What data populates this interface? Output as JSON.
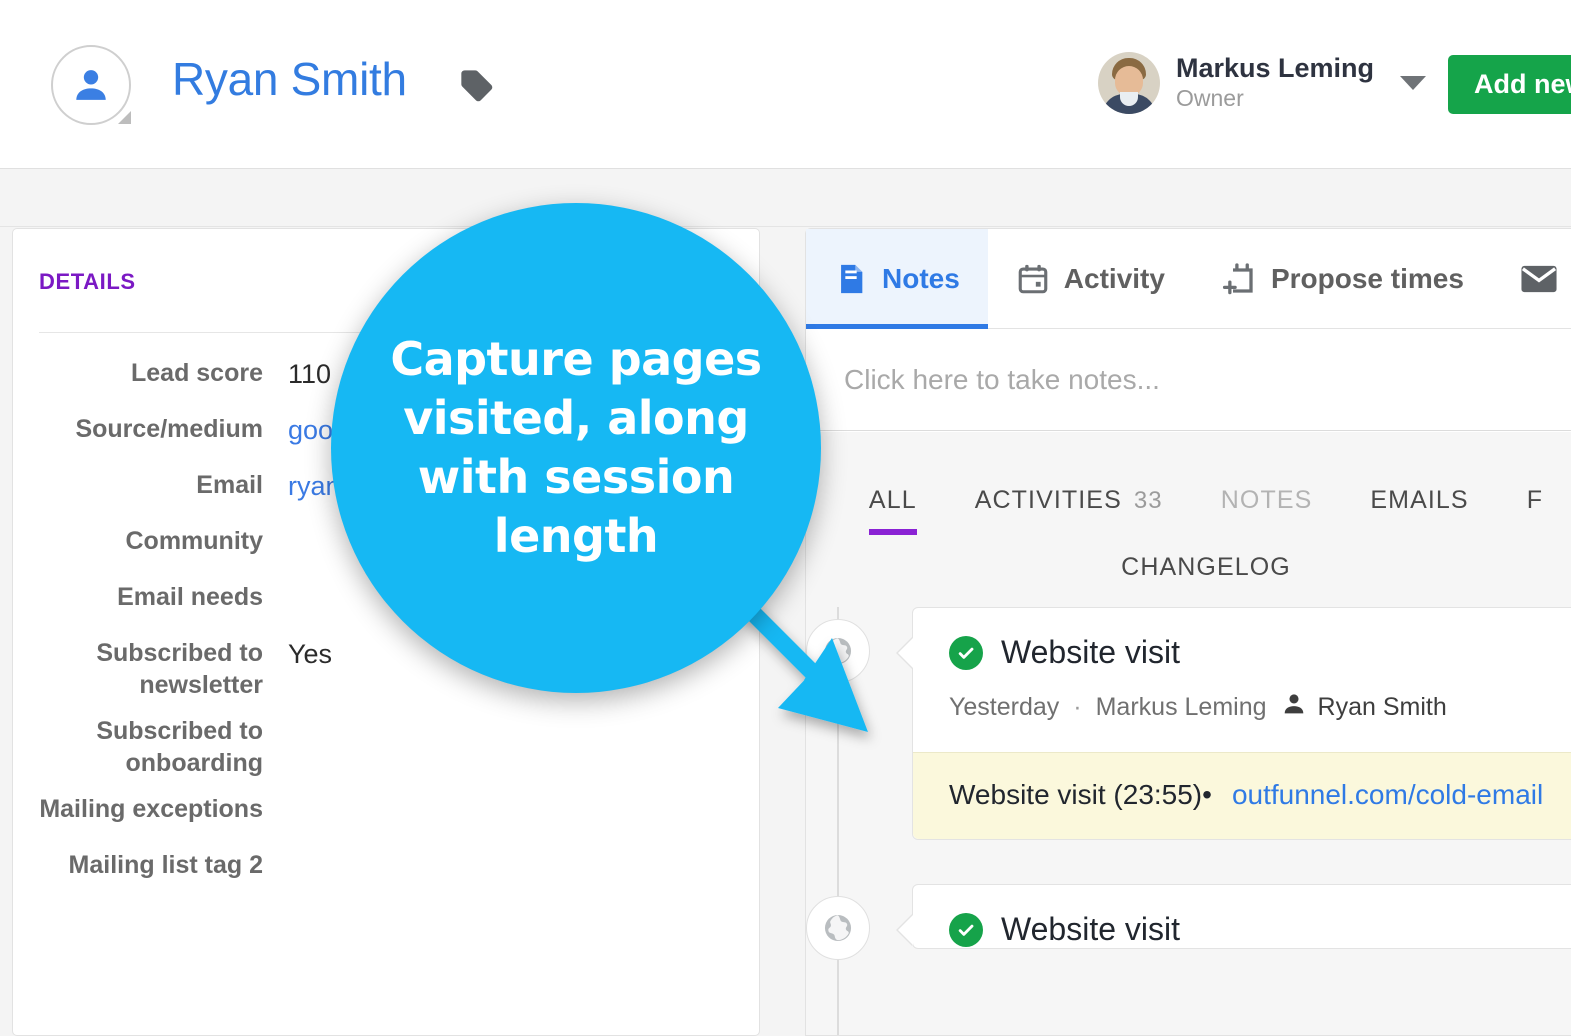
{
  "header": {
    "contact_name": "Ryan Smith",
    "tag_icon": "tag-icon",
    "avatar_icon": "person-avatar-icon",
    "user": {
      "name": "Markus Leming",
      "role": "Owner",
      "avatar": "user-photo-avatar"
    },
    "add_new_label": "Add new"
  },
  "details": {
    "section_title": "DETAILS",
    "fields": [
      {
        "label": "Lead score",
        "value": "110",
        "is_link": false
      },
      {
        "label": "Source/medium",
        "value": "goog",
        "is_link": true
      },
      {
        "label": "Email",
        "value": "ryan@",
        "is_link": true
      },
      {
        "label": "Community",
        "value": "",
        "is_link": false
      },
      {
        "label": "Email needs",
        "value": "",
        "is_link": false
      },
      {
        "label": "Subscribed to newsletter",
        "value": "Yes",
        "is_link": false
      },
      {
        "label": "Subscribed to onboarding",
        "value": "",
        "is_link": false
      },
      {
        "label": "Mailing exceptions",
        "value": "",
        "is_link": false
      },
      {
        "label": "Mailing list tag 2",
        "value": "",
        "is_link": false
      }
    ]
  },
  "right_panel": {
    "tabs": [
      {
        "label": "Notes",
        "icon": "notes-icon",
        "active": true
      },
      {
        "label": "Activity",
        "icon": "calendar-icon",
        "active": false
      },
      {
        "label": "Propose times",
        "icon": "calendar-plus-icon",
        "active": false
      },
      {
        "label": "",
        "icon": "envelope-icon",
        "active": false
      }
    ],
    "note_placeholder": "Click here to take notes...",
    "filters": [
      {
        "label": "ALL",
        "count": "",
        "active": true,
        "dim": false
      },
      {
        "label": "ACTIVITIES",
        "count": "33",
        "active": false,
        "dim": false
      },
      {
        "label": "NOTES",
        "count": "",
        "active": false,
        "dim": true
      },
      {
        "label": "EMAILS",
        "count": "",
        "active": false,
        "dim": false
      },
      {
        "label": "F",
        "count": "",
        "active": false,
        "dim": false
      }
    ],
    "filters_row2": [
      {
        "label": "CHANGELOG",
        "count": "",
        "active": false,
        "dim": false
      }
    ],
    "timeline": [
      {
        "icon": "globe-icon",
        "status_icon": "check-circle-icon",
        "title": "Website visit",
        "date": "Yesterday",
        "separator": "·",
        "owner": "Markus Leming",
        "contact_icon": "person-icon",
        "contact": "Ryan Smith",
        "detail_label": "Website visit (23:55)•",
        "detail_url": "outfunnel.com/cold-email",
        "has_detail": true
      },
      {
        "icon": "globe-icon",
        "status_icon": "check-circle-icon",
        "title": "Website visit",
        "date": "",
        "separator": "",
        "owner": "",
        "contact_icon": "person-icon",
        "contact": "",
        "detail_label": "",
        "detail_url": "",
        "has_detail": false
      }
    ]
  },
  "callout": {
    "text": "Capture pages visited, along with session length",
    "color": "#16b8f3"
  },
  "colors": {
    "accent_blue": "#337ce0",
    "purple": "#7b19c4",
    "green": "#15a44a",
    "callout": "#16b8f3",
    "highlight_yellow": "#fbf8dc"
  }
}
